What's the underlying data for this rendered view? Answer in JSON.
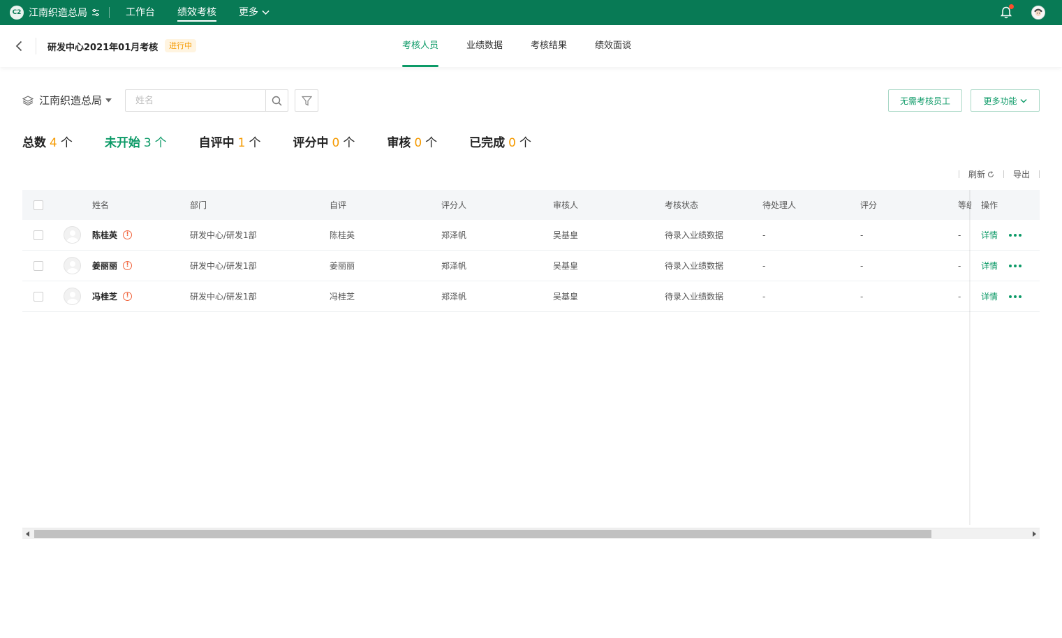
{
  "topnav": {
    "brand_logo": "C2",
    "brand_name": "江南织造总局",
    "items": [
      {
        "label": "工作台",
        "active": false
      },
      {
        "label": "绩效考核",
        "active": true
      },
      {
        "label": "更多",
        "active": false
      }
    ],
    "colors": {
      "bar": "#087a55",
      "notification_dot": "#ff4d2d"
    }
  },
  "subheader": {
    "title": "研发中心2021年01月考核",
    "status_badge": "进行中",
    "tabs": [
      {
        "label": "考核人员",
        "active": true
      },
      {
        "label": "业绩数据",
        "active": false
      },
      {
        "label": "考核结果",
        "active": false
      },
      {
        "label": "绩效面谈",
        "active": false
      }
    ]
  },
  "toolbar": {
    "org_selector": "江南织造总局",
    "search_placeholder": "姓名",
    "search_value": "",
    "btn_no_exam": "无需考核员工",
    "btn_more_functions": "更多功能"
  },
  "stats": [
    {
      "label": "总数",
      "value": "4",
      "unit": "个"
    },
    {
      "label": "未开始",
      "value": "3",
      "unit": "个"
    },
    {
      "label": "自评中",
      "value": "1",
      "unit": "个"
    },
    {
      "label": "评分中",
      "value": "0",
      "unit": "个"
    },
    {
      "label": "审核",
      "value": "0",
      "unit": "个"
    },
    {
      "label": "已完成",
      "value": "0",
      "unit": "个"
    }
  ],
  "table_actions": {
    "refresh": "刷新",
    "export": "导出"
  },
  "table": {
    "columns": [
      "姓名",
      "部门",
      "自评",
      "评分人",
      "审核人",
      "考核状态",
      "待处理人",
      "评分",
      "等级",
      "操作"
    ],
    "rows": [
      {
        "name": "陈桂英",
        "dept": "研发中心/研发1部",
        "self": "陈桂英",
        "rater": "郑泽帆",
        "reviewer": "吴基皇",
        "status": "待录入业绩数据",
        "handler": "-",
        "score": "-",
        "grade": "-",
        "detail": "详情"
      },
      {
        "name": "姜丽丽",
        "dept": "研发中心/研发1部",
        "self": "姜丽丽",
        "rater": "郑泽帆",
        "reviewer": "吴基皇",
        "status": "待录入业绩数据",
        "handler": "-",
        "score": "-",
        "grade": "-",
        "detail": "详情"
      },
      {
        "name": "冯桂芝",
        "dept": "研发中心/研发1部",
        "self": "冯桂芝",
        "rater": "郑泽帆",
        "reviewer": "吴基皇",
        "status": "待录入业绩数据",
        "handler": "-",
        "score": "-",
        "grade": "-",
        "detail": "详情"
      }
    ]
  },
  "icons": [
    "chevron-left-icon",
    "bell-icon",
    "layers-icon",
    "search-icon",
    "filter-icon",
    "refresh-icon",
    "warning-icon",
    "more-dots-icon"
  ],
  "accent_color": "#0c9a67",
  "warning_color": "#f59a00",
  "scroll": {
    "horizontal_thumb_fraction": 0.88
  }
}
